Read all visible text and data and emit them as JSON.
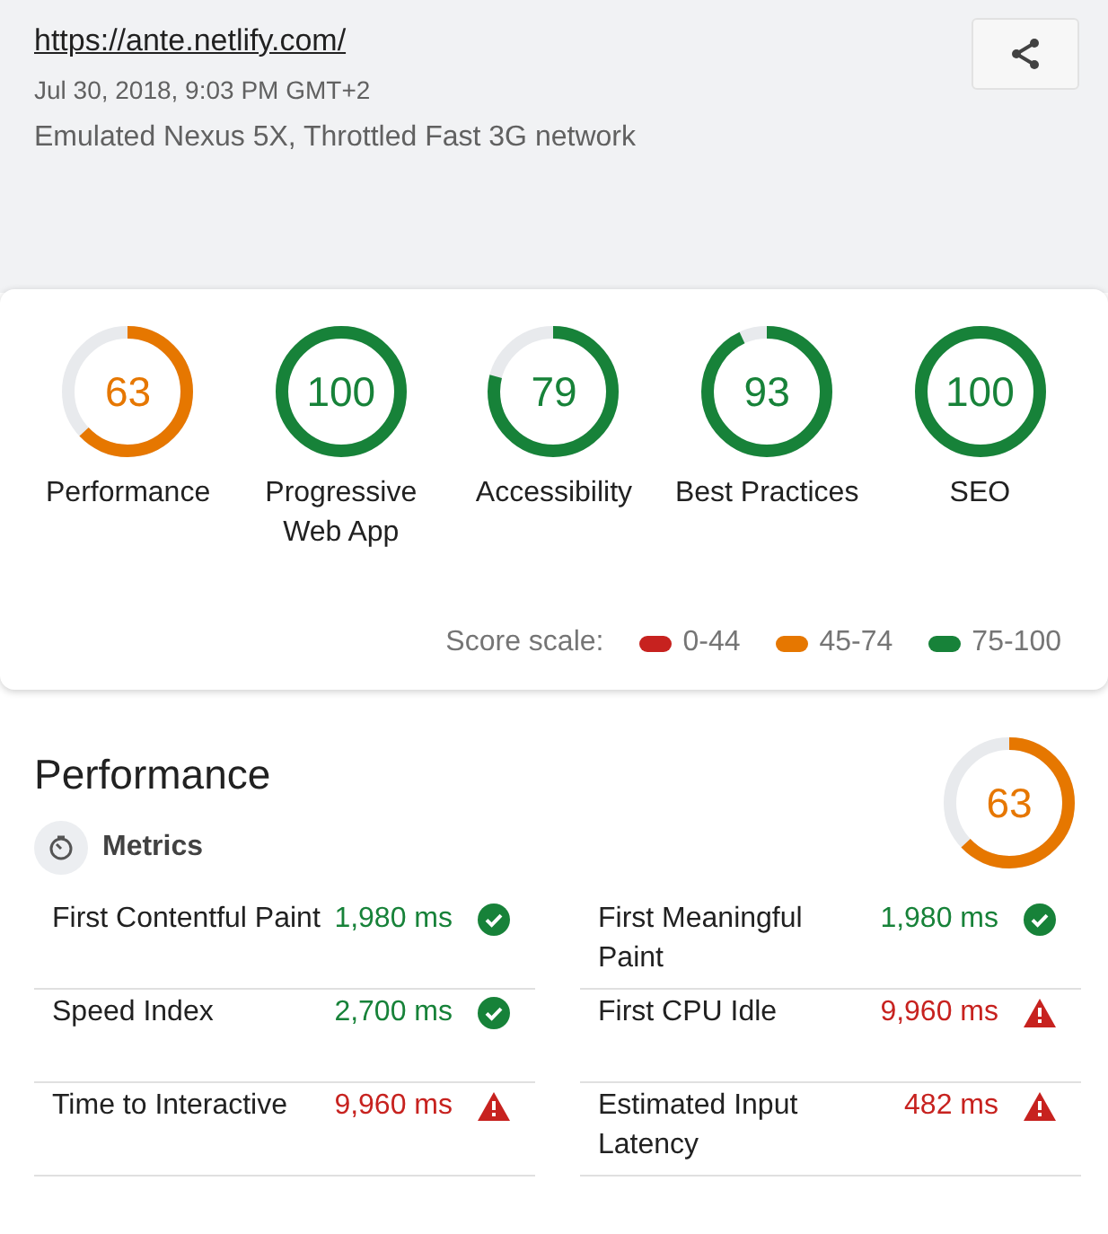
{
  "header": {
    "url": "https://ante.netlify.com/",
    "date": "Jul 30, 2018, 9:03 PM GMT+2",
    "environment": "Emulated Nexus 5X, Throttled Fast 3G network"
  },
  "categories": [
    {
      "label": "Performance",
      "score": "63",
      "color": "#e67700"
    },
    {
      "label": "Progressive Web App",
      "score": "100",
      "color": "#178239"
    },
    {
      "label": "Accessibility",
      "score": "79",
      "color": "#178239"
    },
    {
      "label": "Best Practices",
      "score": "93",
      "color": "#178239"
    },
    {
      "label": "SEO",
      "score": "100",
      "color": "#178239"
    }
  ],
  "score_scale": {
    "label": "Score scale:",
    "items": [
      {
        "range": "0-44",
        "color": "#c7221f"
      },
      {
        "range": "45-74",
        "color": "#e67700"
      },
      {
        "range": "75-100",
        "color": "#178239"
      }
    ]
  },
  "performance": {
    "title": "Performance",
    "score": "63",
    "color": "#e67700",
    "metrics_title": "Metrics",
    "metrics": [
      {
        "name": "First Contentful Paint",
        "value": "1,980 ms",
        "kind": "pass"
      },
      {
        "name": "First Meaningful Paint",
        "value": "1,980 ms",
        "kind": "pass"
      },
      {
        "name": "Speed Index",
        "value": "2,700 ms",
        "kind": "pass"
      },
      {
        "name": "First CPU Idle",
        "value": "9,960 ms",
        "kind": "fail"
      },
      {
        "name": "Time to Interactive",
        "value": "9,960 ms",
        "kind": "fail"
      },
      {
        "name": "Estimated Input Latency",
        "value": "482 ms",
        "kind": "fail"
      }
    ]
  }
}
